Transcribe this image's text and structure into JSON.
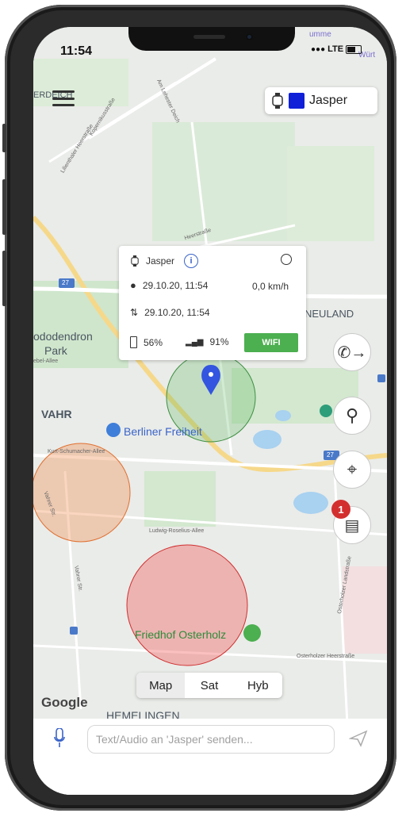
{
  "status": {
    "time": "11:54",
    "network": "LTE"
  },
  "map": {
    "labels": {
      "rhododendron": "ododendron",
      "park": "Park",
      "vahr": "VAHR",
      "neuland": "NEULAND",
      "berliner_freiheit": "Berliner Freiheit",
      "friedhof": "Friedhof Osterholz",
      "hemelingen": "HEMELINGEN",
      "erdeich": "ERDEICH",
      "dammweg": "umme",
      "wurm": "Würt"
    },
    "roads": {
      "lilienthaler": "Lilienthaler Heerstraße",
      "kopernikus": "Kopernikusstraße",
      "lehester_deich": "Am Lehester Deich",
      "heerstrasse": "Heerstraße",
      "kurt_schumacher": "Kurt-Schumacher-Allee",
      "vahrer_str": "Vahrer Str.",
      "vahrer_str2": "Vahrer Str.",
      "ludwig_roselius": "Ludwig-Roselius-Allee",
      "osterholzer_landstrasse": "Osterholzer Landstraße",
      "osterholzer_heerstrasse": "Osterholzer Heerstraße",
      "ebel_allee": "ebel-Allee",
      "route27a": "27",
      "route27b": "27"
    },
    "toggle": {
      "map": "Map",
      "sat": "Sat",
      "hyb": "Hyb",
      "active": "Map"
    },
    "attribution": "Google"
  },
  "tracker": {
    "name": "Jasper",
    "color": "#1020d8"
  },
  "info_card": {
    "name": "Jasper",
    "position_time": "29.10.20, 11:54",
    "speed": "0,0 km/h",
    "sync_time": "29.10.20, 11:54",
    "battery": "56%",
    "signal": "91%",
    "connection": "WIFI"
  },
  "chat": {
    "unread": "1"
  },
  "composer": {
    "placeholder": "Text/Audio an 'Jasper' senden..."
  },
  "colors": {
    "accent_green": "#4caf50",
    "badge_red": "#d32f2f",
    "marker_blue": "#3355e0"
  }
}
